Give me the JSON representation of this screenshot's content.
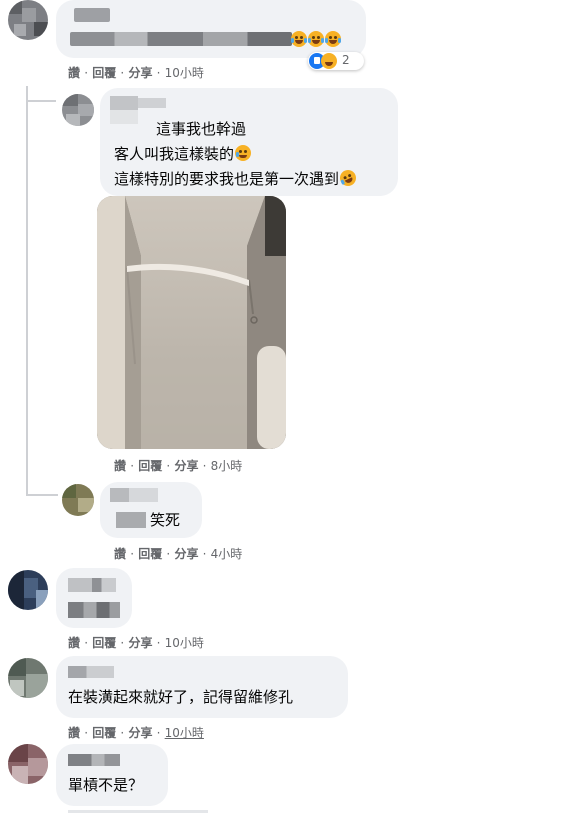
{
  "comments": [
    {
      "author_blurred": true,
      "text_blurred": true,
      "emoji": [
        "laughing-tears-emoji",
        "laughing-tears-emoji",
        "laughing-tears-emoji"
      ],
      "reactions": {
        "icons": [
          "like-icon",
          "haha-icon"
        ],
        "count": "2"
      },
      "actions": {
        "like": "讚",
        "reply": "回覆",
        "share": "分享",
        "time": "10小時"
      }
    },
    {
      "author_blurred": true,
      "lines": [
        "這事我也幹過",
        "客人叫我這樣裝的",
        "這樣特別的要求我也是第一次遇到"
      ],
      "line_emoji": [
        "",
        "crying-emoji",
        "rolling-laughing-emoji"
      ],
      "has_photo": true,
      "photo_description_icon": "closet-photo",
      "actions": {
        "like": "讚",
        "reply": "回覆",
        "share": "分享",
        "time": "8小時"
      }
    },
    {
      "author_blurred": true,
      "text": "笑死",
      "actions": {
        "like": "讚",
        "reply": "回覆",
        "share": "分享",
        "time": "4小時"
      }
    },
    {
      "author_blurred": true,
      "text_blurred": true,
      "actions": {
        "like": "讚",
        "reply": "回覆",
        "share": "分享",
        "time": "10小時"
      }
    },
    {
      "author_blurred": true,
      "text": "在裝潢起來就好了，記得留維修孔",
      "actions": {
        "like": "讚",
        "reply": "回覆",
        "share": "分享",
        "time": "10小時"
      }
    },
    {
      "author_blurred": true,
      "text": "單槓不是？"
    }
  ],
  "separator": "·",
  "colors": {
    "bubble": "#f0f2f5",
    "meta": "#65676b",
    "like_blue": "#1877f2",
    "emoji_yellow": "#f7b125"
  }
}
